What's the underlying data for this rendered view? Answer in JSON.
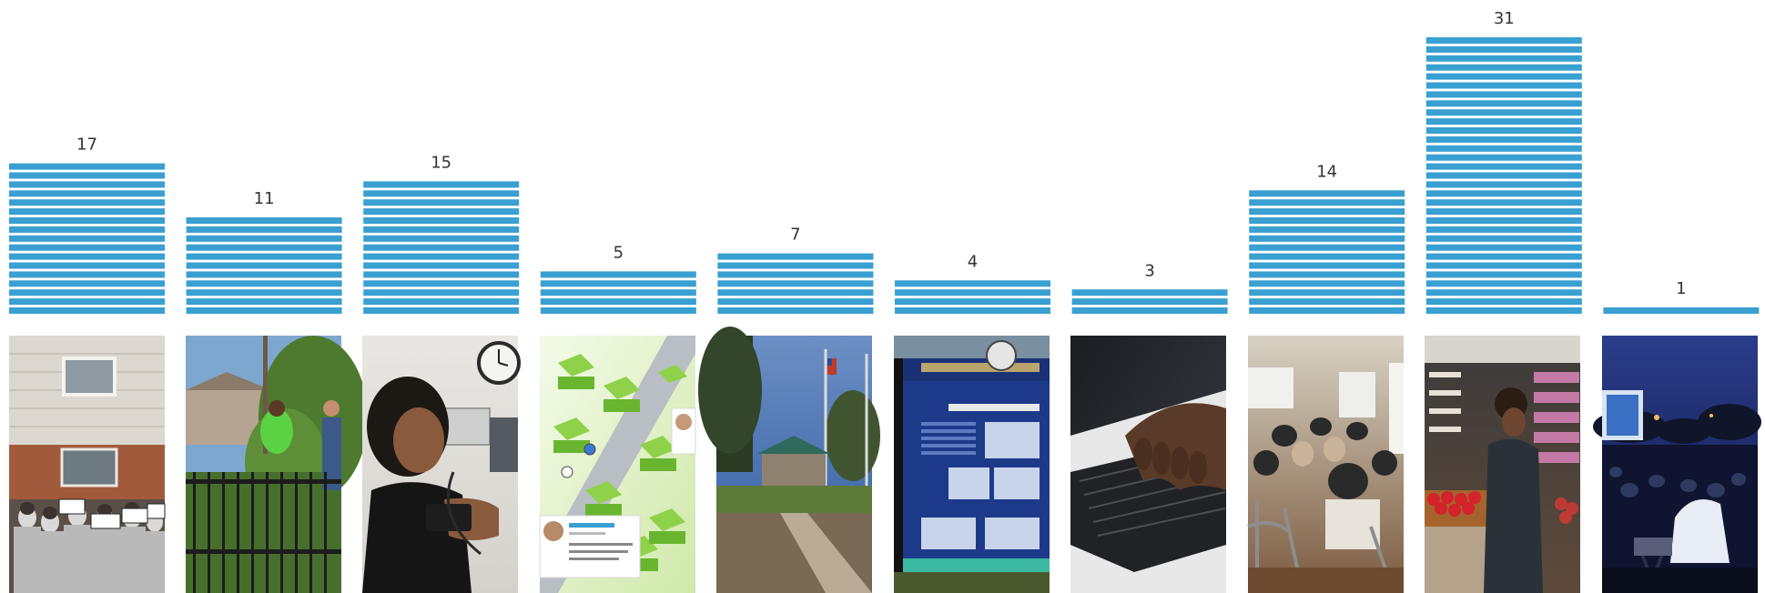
{
  "chart_data": {
    "type": "bar",
    "values": [
      17,
      11,
      15,
      5,
      7,
      4,
      3,
      14,
      31,
      1
    ],
    "value_labels": [
      "17",
      "11",
      "15",
      "5",
      "7",
      "4",
      "3",
      "14",
      "31",
      "1"
    ],
    "bar_style": "stacked unit stripes",
    "bar_color": "#3a9fd1",
    "ylim": [
      0,
      31
    ],
    "grid": false,
    "legend": "none",
    "photos": [
      "house-protest-photo",
      "garden-fence-photo",
      "blood-pressure-photo",
      "neighborhood-app-illustration",
      "park-gazebo-photo",
      "heritage-sign-photo",
      "keyboard-typing-photo",
      "meeting-room-photo",
      "grocery-store-photo",
      "outdoor-movie-photo"
    ]
  }
}
